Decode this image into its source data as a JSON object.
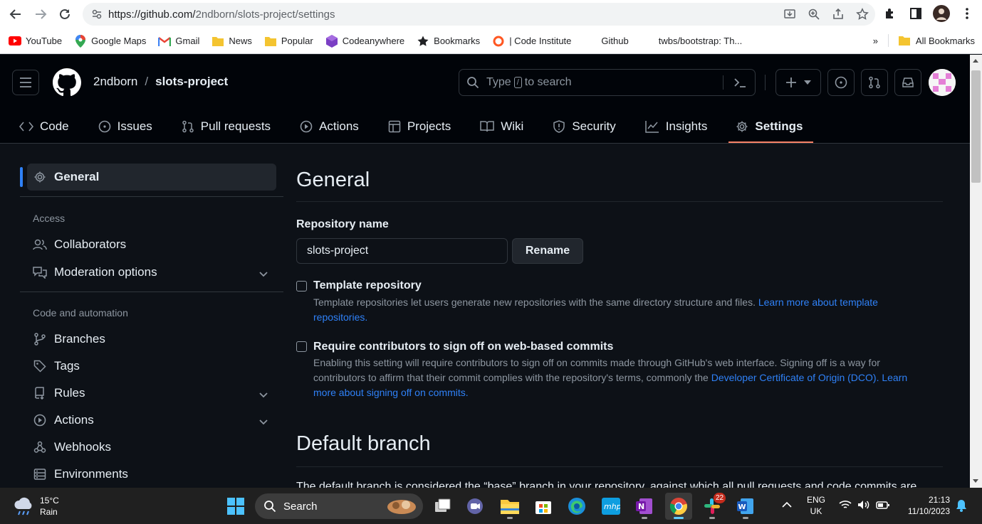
{
  "browser": {
    "url_host": "https://github.com/",
    "url_path": "2ndborn/slots-project/settings",
    "bookmarks": [
      {
        "label": "YouTube",
        "icon": "youtube-icon",
        "color": "#ff0000"
      },
      {
        "label": "Google Maps",
        "icon": "maps-pin-icon",
        "color": "#34a853"
      },
      {
        "label": "Gmail",
        "icon": "gmail-icon",
        "color": "#ea4335"
      },
      {
        "label": "News",
        "icon": "folder-icon",
        "color": "#f4c430"
      },
      {
        "label": "Popular",
        "icon": "folder-icon",
        "color": "#f4c430"
      },
      {
        "label": "Codeanywhere",
        "icon": "cube-icon",
        "color": "#7b3fc4"
      },
      {
        "label": "Bookmarks",
        "icon": "star-icon",
        "color": "#202124"
      },
      {
        "label": "| Code Institute",
        "icon": "ring-icon",
        "color": "#ff5722"
      },
      {
        "label": "Github",
        "icon": "",
        "color": ""
      },
      {
        "label": "twbs/bootstrap: Th...",
        "icon": "",
        "color": ""
      }
    ],
    "more_label": "»",
    "all_bookmarks_label": "All Bookmarks"
  },
  "github": {
    "owner": "2ndborn",
    "separator": "/",
    "repo": "slots-project",
    "search_prefix": "Type",
    "search_kbd": "/",
    "search_suffix": "to search",
    "tabs": [
      {
        "label": "Code",
        "icon": "code-icon"
      },
      {
        "label": "Issues",
        "icon": "issue-icon"
      },
      {
        "label": "Pull requests",
        "icon": "pull-request-icon"
      },
      {
        "label": "Actions",
        "icon": "play-icon"
      },
      {
        "label": "Projects",
        "icon": "table-icon"
      },
      {
        "label": "Wiki",
        "icon": "book-icon"
      },
      {
        "label": "Security",
        "icon": "shield-icon"
      },
      {
        "label": "Insights",
        "icon": "graph-icon"
      },
      {
        "label": "Settings",
        "icon": "gear-icon",
        "active": true
      }
    ]
  },
  "sidebar": {
    "general": "General",
    "access_heading": "Access",
    "collaborators": "Collaborators",
    "moderation": "Moderation options",
    "code_heading": "Code and automation",
    "branches": "Branches",
    "tags": "Tags",
    "rules": "Rules",
    "actions": "Actions",
    "webhooks": "Webhooks",
    "environments": "Environments"
  },
  "main": {
    "title": "General",
    "repo_name_label": "Repository name",
    "repo_name_value": "slots-project",
    "rename_label": "Rename",
    "template_title": "Template repository",
    "template_desc": "Template repositories let users generate new repositories with the same directory structure and files.",
    "template_link_1": "Learn more about template",
    "template_link_2": "repositories.",
    "signoff_title": "Require contributors to sign off on web-based commits",
    "signoff_desc_1": "Enabling this setting will require contributors to sign off on commits made through GitHub's web interface. Signing off is a way for",
    "signoff_desc_2": "contributors to affirm that their commit complies with the repository's terms, commonly the",
    "signoff_link_1": "Developer Certificate of Origin (DCO).",
    "signoff_link_2": "Learn",
    "signoff_link_3": "more about signing off on commits.",
    "default_branch_title": "Default branch",
    "default_branch_desc": "The default branch is considered the “base” branch in your repository, against which all pull requests and code commits are"
  },
  "taskbar": {
    "temperature": "15°C",
    "weather": "Rain",
    "search_label": "Search",
    "notification_badge": "22",
    "lang_1": "ENG",
    "lang_2": "UK",
    "time": "21:13",
    "date": "11/10/2023"
  }
}
